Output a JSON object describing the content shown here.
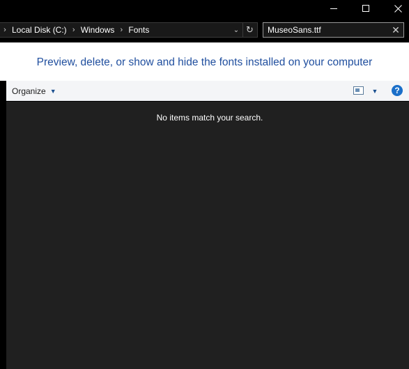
{
  "titlebar": {
    "minimize_glyph": "—",
    "close_glyph": "✕"
  },
  "address": {
    "leading_chevron": "›",
    "crumbs": [
      "Local Disk (C:)",
      "Windows",
      "Fonts"
    ],
    "separator": "›",
    "dropdown_glyph": "⌄",
    "refresh_glyph": "↻"
  },
  "search": {
    "value": "MuseoSans.ttf",
    "clear_glyph": "✕"
  },
  "banner": {
    "text": "Preview, delete, or show and hide the fonts installed on your computer"
  },
  "toolbar": {
    "organize_label": "Organize",
    "dropdown_glyph": "▼",
    "help_glyph": "?"
  },
  "content": {
    "empty_message": "No items match your search."
  },
  "icons": {
    "view": "view-options-icon",
    "help": "help-icon",
    "refresh": "refresh-icon"
  },
  "colors": {
    "banner_text": "#1f4e9e",
    "help_button": "#1a6fc9",
    "content_background": "#202020"
  }
}
